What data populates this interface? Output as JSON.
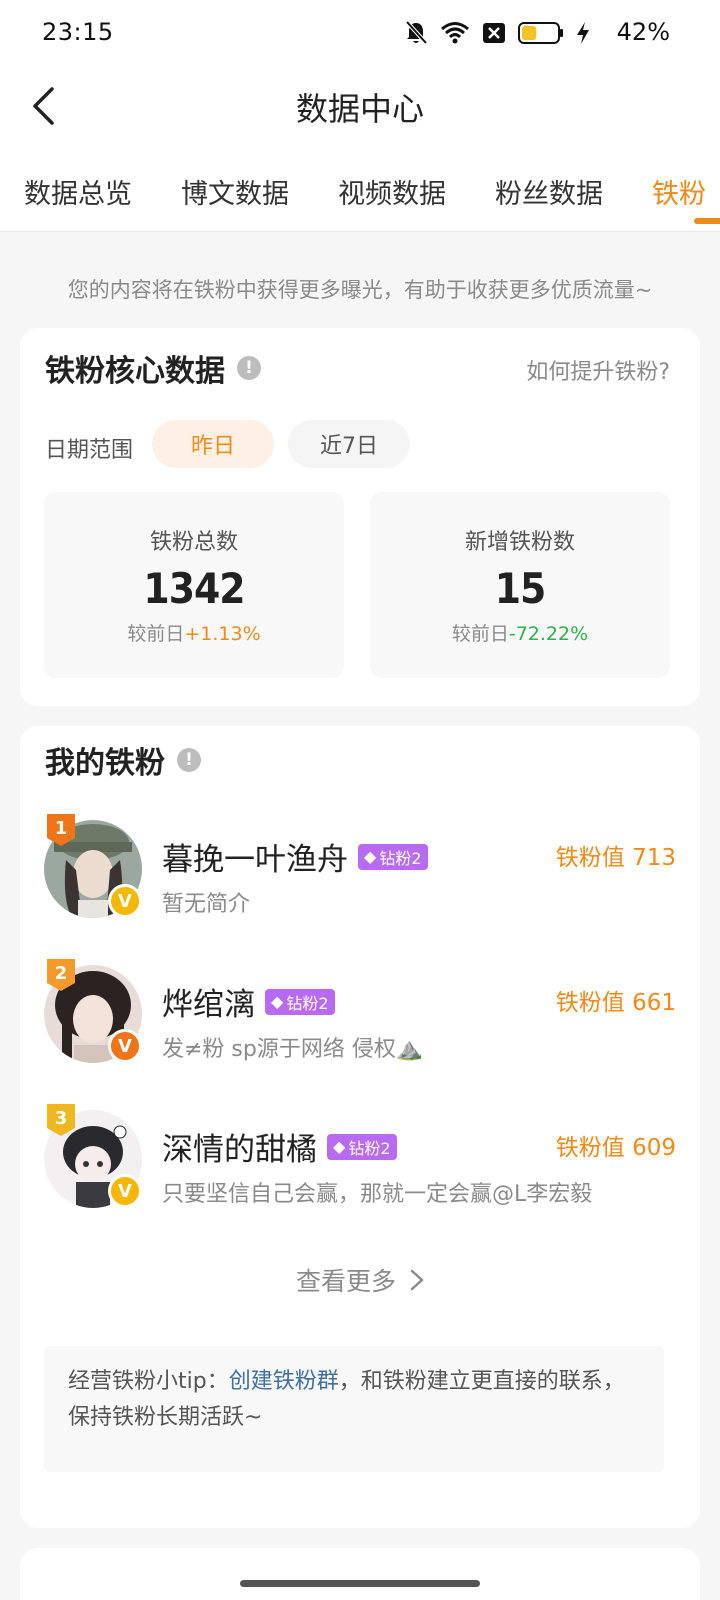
{
  "status_bar": {
    "time": "23:15",
    "battery_percent": "42%",
    "battery_level": 0.42,
    "icons": [
      "bell-off-icon",
      "wifi-icon",
      "sim-x-icon",
      "battery-icon",
      "charging-bolt-icon"
    ]
  },
  "nav": {
    "title": "数据中心"
  },
  "tabs": [
    {
      "label": "数据总览",
      "active": false
    },
    {
      "label": "博文数据",
      "active": false
    },
    {
      "label": "视频数据",
      "active": false
    },
    {
      "label": "粉丝数据",
      "active": false
    },
    {
      "label": "铁粉",
      "active": true
    }
  ],
  "notice": "您的内容将在铁粉中获得更多曝光，有助于收获更多优质流量~",
  "core": {
    "title": "铁粉核心数据",
    "help_link": "如何提升铁粉?",
    "range_label": "日期范围",
    "range_options": [
      "昨日",
      "近7日"
    ],
    "stats": [
      {
        "label": "铁粉总数",
        "value": "1342",
        "cmp_prefix": "较前日",
        "cmp_value": "+1.13%"
      },
      {
        "label": "新增铁粉数",
        "value": "15",
        "cmp_prefix": "较前日",
        "cmp_value": "-72.22%"
      }
    ]
  },
  "fans": {
    "title": "我的铁粉",
    "score_prefix": "铁粉值",
    "items": [
      {
        "rank": "1",
        "name": "暮挽一叶渔舟",
        "tag": "钻粉2",
        "bio": "暂无简介",
        "score": "713"
      },
      {
        "rank": "2",
        "name": "烨绾漓",
        "tag": "钻粉2",
        "bio": "发≠粉 sp源于网络 侵权⛰️",
        "score": "661"
      },
      {
        "rank": "3",
        "name": "深情的甜橘",
        "tag": "钻粉2",
        "bio": "只要坚信自己会赢，那就一定会赢@L李宏毅",
        "score": "609"
      }
    ],
    "see_more": "查看更多",
    "tip_prefix": "经营铁粉小tip：",
    "tip_link": "创建铁粉群",
    "tip_suffix": "，和铁粉建立更直接的联系，保持铁粉长期活跃~"
  },
  "colors": {
    "accent": "#f18a18",
    "down": "#2fb14a",
    "link": "#3f6fa0",
    "tag": "#b96af3"
  }
}
